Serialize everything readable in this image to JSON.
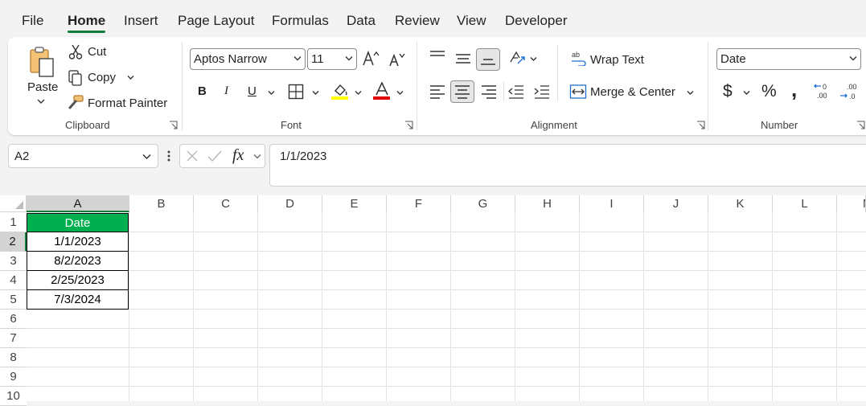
{
  "menu": {
    "tabs": [
      {
        "label": "File"
      },
      {
        "label": "Home"
      },
      {
        "label": "Insert"
      },
      {
        "label": "Page Layout"
      },
      {
        "label": "Formulas"
      },
      {
        "label": "Data"
      },
      {
        "label": "Review"
      },
      {
        "label": "View"
      },
      {
        "label": "Developer"
      }
    ],
    "active": "Home"
  },
  "ribbon": {
    "clipboard": {
      "label": "Clipboard",
      "paste": "Paste",
      "cut": "Cut",
      "copy": "Copy",
      "format_painter": "Format Painter"
    },
    "font": {
      "label": "Font",
      "font_name": "Aptos Narrow",
      "font_size": "11",
      "bold": "B",
      "italic": "I",
      "underline": "U",
      "highlight_color": "#ffff00",
      "font_color": "#e00000"
    },
    "alignment": {
      "label": "Alignment",
      "wrap_text": "Wrap Text",
      "merge_center": "Merge & Center"
    },
    "number": {
      "label": "Number",
      "format": "Date",
      "currency": "$",
      "percent": "%",
      "comma": ","
    }
  },
  "formula_bar": {
    "name_box": "A2",
    "fx": "fx",
    "content": "1/1/2023"
  },
  "sheet": {
    "columns": [
      "A",
      "B",
      "C",
      "D",
      "E",
      "F",
      "G",
      "H",
      "I",
      "J",
      "K",
      "L",
      "M"
    ],
    "rows": [
      "1",
      "2",
      "3",
      "4",
      "5",
      "6",
      "7",
      "8",
      "9",
      "10"
    ],
    "header_cell": "Date",
    "header_fill": "#00b050",
    "values": [
      "1/1/2023",
      "8/2/2023",
      "2/25/2023",
      "7/3/2024"
    ],
    "selected_cell": "A2"
  },
  "colors": {
    "accent": "#117e3a"
  }
}
